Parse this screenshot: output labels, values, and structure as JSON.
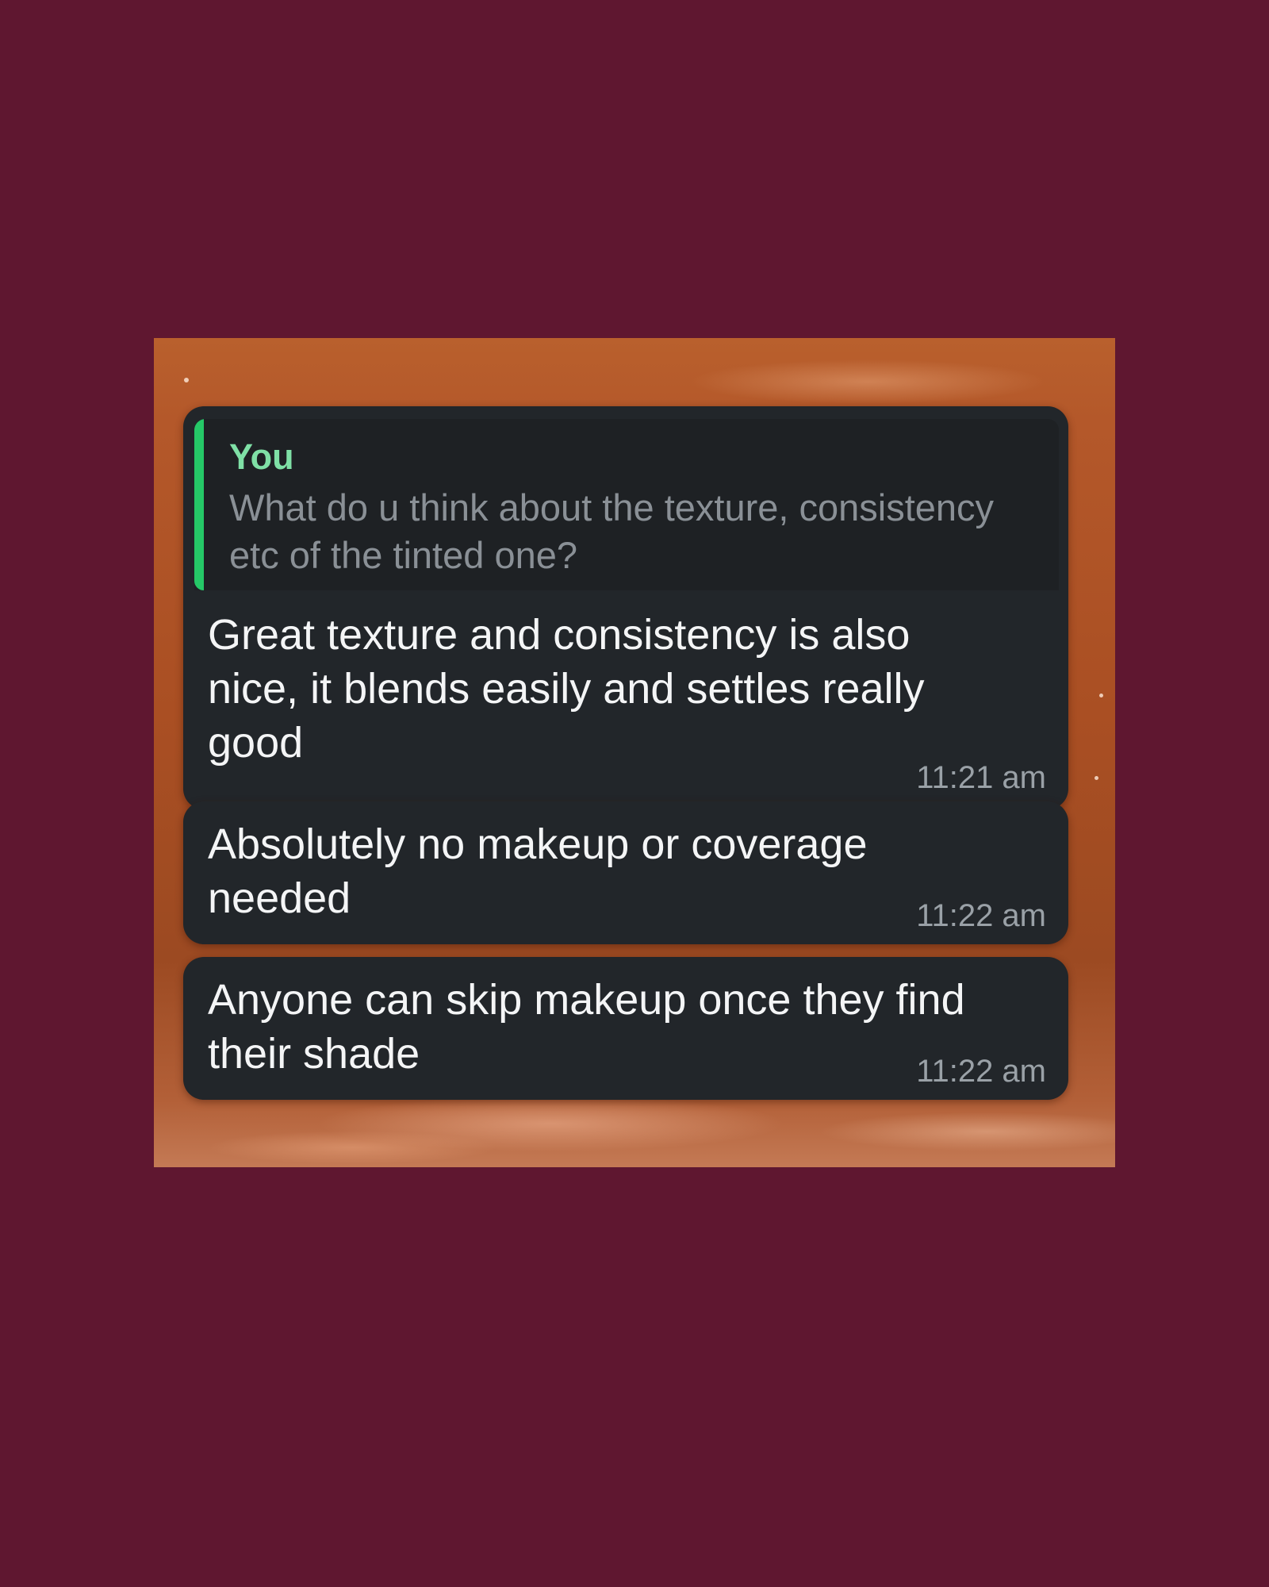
{
  "background_color": "#5f1730",
  "bubble_color": "#22262a",
  "accent_color": "#25c867",
  "quoted_reply": {
    "author": "You",
    "text": "What do u think about the texture, consistency etc of the tinted one?"
  },
  "messages": [
    {
      "text": "Great texture and consistency is also nice, it blends easily and settles really good",
      "time": "11:21 am"
    },
    {
      "text": "Absolutely no makeup or coverage needed",
      "time": "11:22 am"
    },
    {
      "text": "Anyone can skip makeup once they find their shade",
      "time": "11:22 am"
    }
  ]
}
